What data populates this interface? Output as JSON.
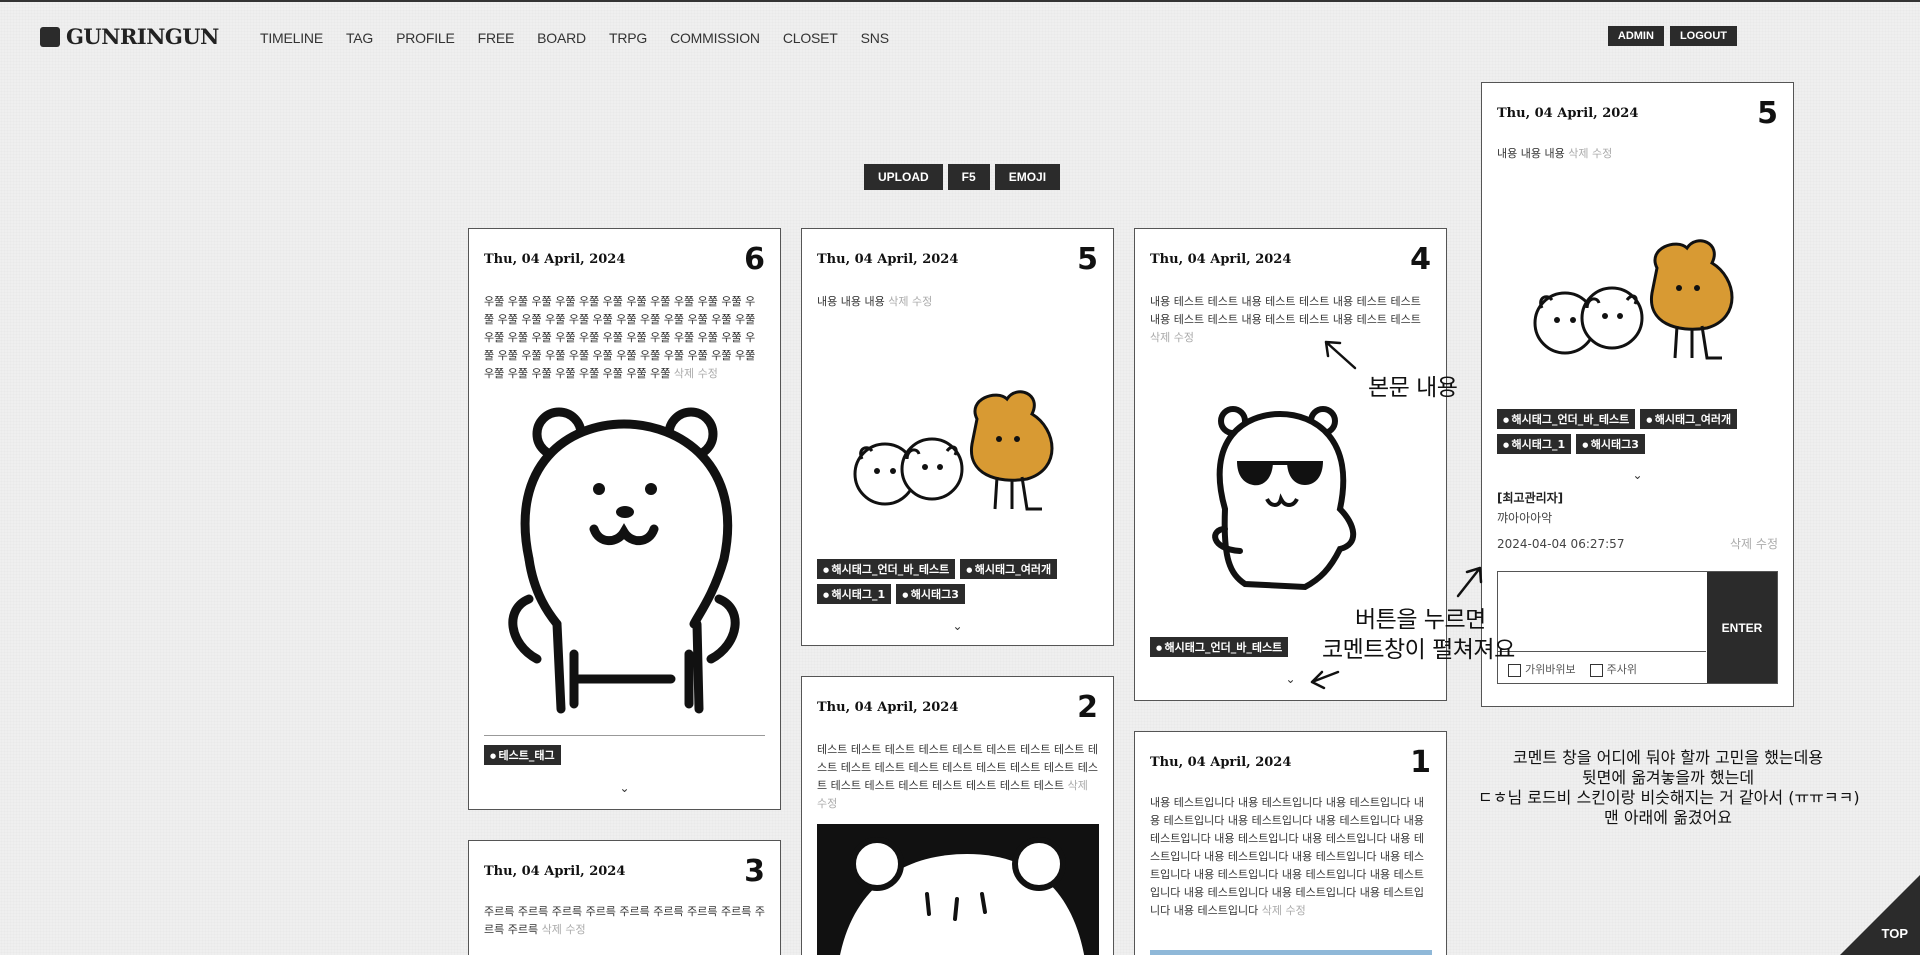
{
  "site": {
    "logo": "GUNRINGUN"
  },
  "nav": [
    "TIMELINE",
    "TAG",
    "PROFILE",
    "FREE",
    "BOARD",
    "TRPG",
    "COMMISSION",
    "CLOSET",
    "SNS"
  ],
  "auth": {
    "admin": "ADMIN",
    "logout": "LOGOUT"
  },
  "toolbar": {
    "upload": "UPLOAD",
    "f5": "F5",
    "emoji": "EMOJI"
  },
  "actions": {
    "delete": "삭제",
    "edit": "수정"
  },
  "posts": {
    "p6": {
      "date": "Thu, 04 April, 2024",
      "num": "6",
      "body": "우쭐 우쭐 우쭐 우쭐 우쭐 우쭐 우쭐 우쭐 우쭐 우쭐 우쭐 우쭐 우쭐 우쭐 우쭐 우쭐 우쭐 우쭐 우쭐 우쭐 우쭐 우쭐 우쭐 우쭐 우쭐 우쭐 우쭐 우쭐 우쭐 우쭐 우쭐 우쭐 우쭐 우쭐 우쭐 우쭐 우쭐 우쭐 우쭐 우쭐 우쭐 우쭐 우쭐 우쭐 우쭐 우쭐 우쭐 우쭐 우쭐 우쭐 우쭐 우쭐 우쭐 우쭐",
      "tags": [
        "테스트_태그"
      ]
    },
    "p5": {
      "date": "Thu, 04 April, 2024",
      "num": "5",
      "body": "내용 내용 내용",
      "tags": [
        "해시태그_언더_바_테스트",
        "해시태그_여러개",
        "해시태그_1",
        "해시태그3"
      ]
    },
    "p4": {
      "date": "Thu, 04 April, 2024",
      "num": "4",
      "body": "내용 테스트 테스트 내용 테스트 테스트 내용 테스트 테스트 내용 테스트 테스트 내용 테스트 테스트 내용 테스트 테스트",
      "tags": [
        "해시태그_언더_바_테스트"
      ]
    },
    "p3": {
      "date": "Thu, 04 April, 2024",
      "num": "3",
      "body": "주르륵 주르륵 주르륵 주르륵 주르륵 주르륵 주르륵 주르륵 주르륵 주르륵"
    },
    "p2": {
      "date": "Thu, 04 April, 2024",
      "num": "2",
      "body": "테스트 테스트 테스트 테스트 테스트 테스트 테스트 테스트 테스트 테스트 테스트 테스트 테스트 테스트 테스트 테스트 테스트 테스트 테스트 테스트 테스트 테스트 테스트 테스트"
    },
    "p1": {
      "date": "Thu, 04 April, 2024",
      "num": "1",
      "body": "내용 테스트입니다 내용 테스트입니다 내용 테스트입니다 내용 테스트입니다 내용 테스트입니다 내용 테스트입니다 내용 테스트입니다 내용 테스트입니다 내용 테스트입니다 내용 테스트입니다 내용 테스트입니다 내용 테스트입니다 내용 테스트입니다 내용 테스트입니다 내용 테스트입니다 내용 테스트입니다 내용 테스트입니다 내용 테스트입니다 내용 테스트입니다 내용 테스트입니다"
    },
    "p5x": {
      "date": "Thu, 04 April, 2024",
      "num": "5",
      "body": "내용 내용 내용",
      "tags": [
        "해시태그_언더_바_테스트",
        "해시태그_여러개",
        "해시태그_1",
        "해시태그3"
      ],
      "comment": {
        "author": "[최고관리자]",
        "text": "꺄아아아악",
        "datetime": "2024-04-04 06:27:57"
      },
      "form": {
        "enter": "ENTER",
        "opt1": "가위바위보",
        "opt2": "주사위"
      }
    }
  },
  "annotations": {
    "body": "본문 내용",
    "button_line1": "버튼을 누르면",
    "button_line2": "코멘트창이 펼쳐져요",
    "memo": [
      "코멘트 창을 어디에 둬야 할까 고민을 했는데용",
      "뒷면에 옮겨놓을까 했는데",
      "ㄷㅎ님 로드비 스킨이랑 비슷해지는 거 같아서 (ㅠㅠㅋㅋ)",
      "맨 아래에 옮겼어요"
    ]
  },
  "top": "TOP",
  "colors": {
    "dark": "#2b2b2b",
    "muted": "#aaaaaa",
    "bg": "#efefef"
  }
}
